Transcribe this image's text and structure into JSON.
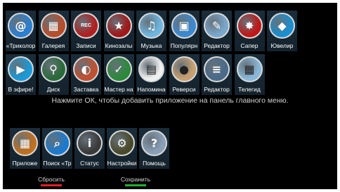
{
  "apps_row1": [
    {
      "label": "«Триколор",
      "icon": "mail-icon",
      "color": "#2b7fd0",
      "glyph": "@"
    },
    {
      "label": "Галерея",
      "icon": "gallery-icon",
      "color": "#b84d2a",
      "glyph": "▦"
    },
    {
      "label": "Записи",
      "icon": "record-icon",
      "color": "#b02020",
      "glyph": "REC"
    },
    {
      "label": "Кинозалы",
      "icon": "cinema-star-icon",
      "color": "#a01818",
      "glyph": "★"
    },
    {
      "label": "Музыка",
      "icon": "music-icon",
      "color": "#6fb6e0",
      "glyph": "♫"
    },
    {
      "label": "Популярн",
      "icon": "popular-apps-icon",
      "color": "#3b8ad0",
      "glyph": "▣"
    },
    {
      "label": "Редактор",
      "icon": "editor-icon",
      "color": "#7aa7cc",
      "glyph": "✎"
    },
    {
      "label": "Сапер",
      "icon": "minesweeper-icon",
      "color": "#c01818",
      "glyph": "✸"
    },
    {
      "label": "Ювелир",
      "icon": "jeweler-icon",
      "color": "#1a8fd0",
      "glyph": "◆"
    }
  ],
  "apps_row2": [
    {
      "label": "В эфире!",
      "icon": "on-air-icon",
      "color": "#1a9ad8",
      "glyph": "▶"
    },
    {
      "label": "Диск",
      "icon": "usb-disk-icon",
      "color": "#2a6a3a",
      "glyph": "⚲"
    },
    {
      "label": "Заставка",
      "icon": "screensaver-icon",
      "color": "#c05030",
      "glyph": "◐"
    },
    {
      "label": "Мастер на",
      "icon": "setup-wizard-icon",
      "color": "#2a8a3a",
      "glyph": "✓"
    },
    {
      "label": "Напомина",
      "icon": "reminder-calendar-icon",
      "color": "#f0f0f0",
      "glyph": "▤"
    },
    {
      "label": "Реверси",
      "icon": "reversi-icon",
      "color": "#c8a070",
      "glyph": "●"
    },
    {
      "label": "Редактор",
      "icon": "channel-editor-icon",
      "color": "#4a6a8a",
      "glyph": "≡"
    },
    {
      "label": "Телегид",
      "icon": "tv-guide-icon",
      "color": "#8ab8d8",
      "glyph": "▦"
    }
  ],
  "hint_text": "Нажмите ОК, чтобы добавить приложение на панель главного меню.",
  "panel_apps": [
    {
      "label": "Приложе",
      "icon": "applications-icon",
      "color": "#c07020",
      "glyph": "▦"
    },
    {
      "label": "Поиск «Тр",
      "icon": "search-tricolor-icon",
      "color": "#1a7ad0",
      "glyph": "⌕"
    },
    {
      "label": "Статус",
      "icon": "status-info-icon",
      "color": "#3a3a3a",
      "glyph": "i"
    },
    {
      "label": "Настройки",
      "icon": "settings-gear-icon",
      "color": "#4a4a2a",
      "glyph": "⚙"
    },
    {
      "label": "Помощь",
      "icon": "help-robot-icon",
      "color": "#8aa0b8",
      "glyph": "?"
    }
  ],
  "softkeys": {
    "reset_label": "Сбросить",
    "reset_color": "#e02020",
    "save_label": "Сохранить",
    "save_color": "#20b030"
  }
}
